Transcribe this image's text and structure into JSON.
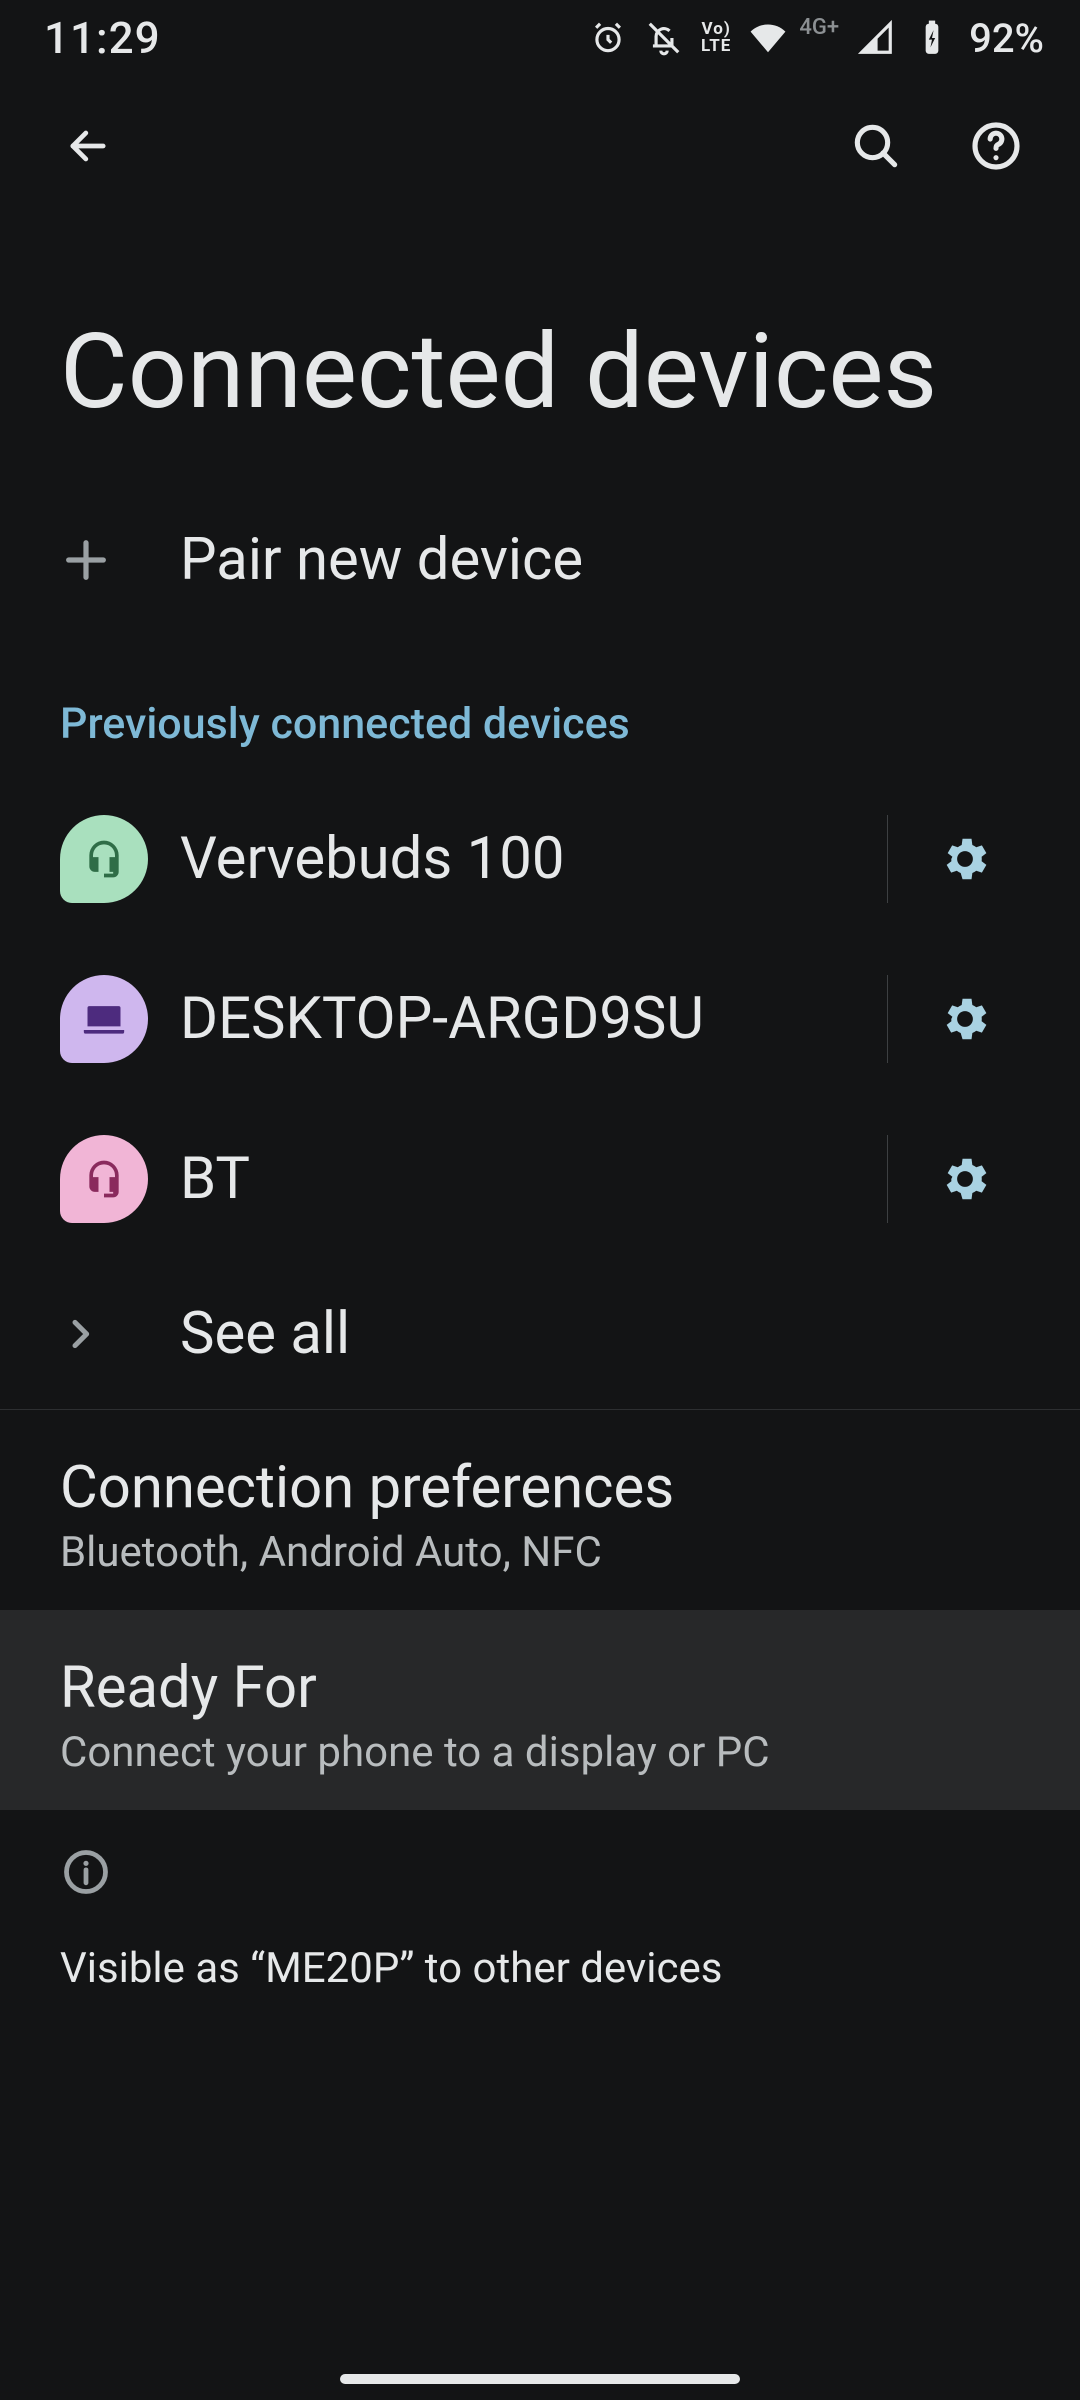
{
  "status": {
    "time": "11:29",
    "net_label": "4G+",
    "battery_text": "92%"
  },
  "header": {
    "title": "Connected devices"
  },
  "pair": {
    "label": "Pair new device"
  },
  "section_label": "Previously connected devices",
  "devices": [
    {
      "name": "Vervebuds 100",
      "icon": "headset",
      "avatar_bg": "#a9e0be",
      "icon_color": "#2f6d47"
    },
    {
      "name": "DESKTOP-ARGD9SU",
      "icon": "laptop",
      "avatar_bg": "#cfb7ee",
      "icon_color": "#4d2b7e"
    },
    {
      "name": "BT",
      "icon": "headset",
      "avatar_bg": "#f1b5d6",
      "icon_color": "#8a2a5d"
    }
  ],
  "see_all": {
    "label": "See all"
  },
  "pref": {
    "title": "Connection preferences",
    "subtitle": "Bluetooth, Android Auto, NFC"
  },
  "ready_for": {
    "title": "Ready For",
    "subtitle": "Connect your phone to a display or PC"
  },
  "footer": {
    "text": "Visible as “ME20P” to other devices"
  }
}
